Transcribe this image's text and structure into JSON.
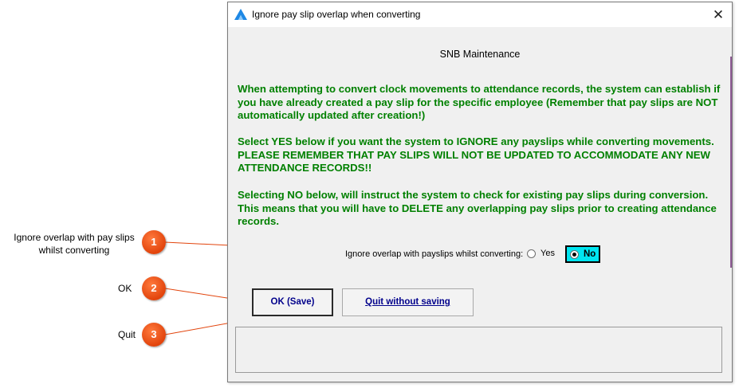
{
  "window": {
    "title": "Ignore pay slip overlap when converting",
    "close_glyph": "✕",
    "app_icon": "arrow-logo-icon"
  },
  "subtitle": "SNB Maintenance",
  "paragraphs": [
    "When attempting to convert clock movements to attendance records, the system can establish if you have already created a pay slip for the specific employee (Remember that pay slips are NOT automatically updated after creation!)",
    "Select YES below if you want the system to IGNORE any payslips while converting movements. PLEASE REMEMBER THAT PAY SLIPS WILL NOT BE UPDATED TO ACCOMMODATE ANY NEW ATTENDANCE RECORDS!!",
    "Selecting NO below, will instruct the system to check for existing pay slips during conversion. This means that you will have to DELETE any overlapping pay slips prior to creating attendance records."
  ],
  "option": {
    "label": "Ignore overlap with payslips whilst converting:",
    "yes_label": "Yes",
    "no_label": "No",
    "selected": "No"
  },
  "buttons": {
    "ok_label": "OK (Save)",
    "quit_label": "Quit without saving"
  },
  "callouts": [
    {
      "number": "1",
      "text": "Ignore overlap with pay slips whilst converting"
    },
    {
      "number": "2",
      "text": "OK"
    },
    {
      "number": "3",
      "text": "Quit"
    }
  ],
  "colors": {
    "paragraph_text": "#008000",
    "selected_option_bg": "#00e5f0",
    "button_text": "#00008b",
    "badge": "#e2440c",
    "leader_line": "#e2440c"
  }
}
